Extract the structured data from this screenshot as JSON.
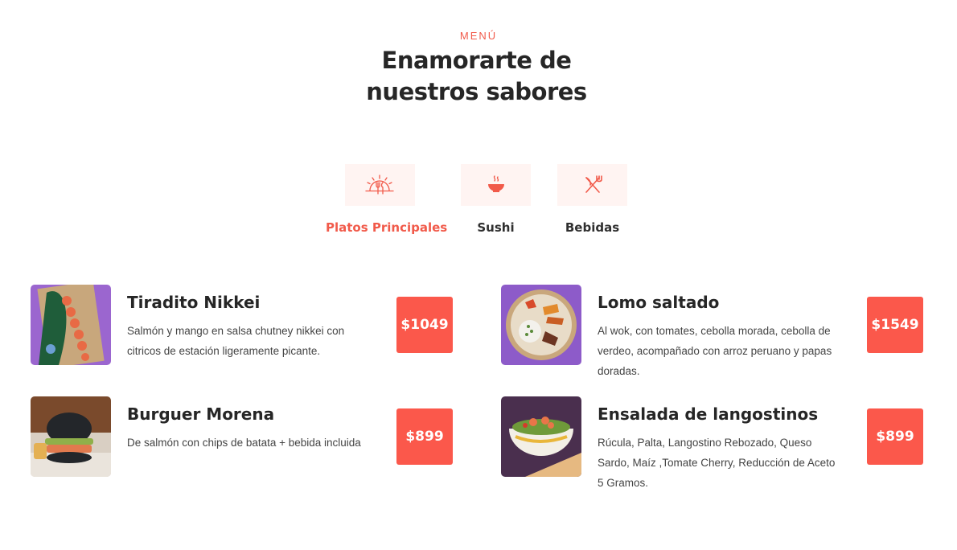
{
  "header": {
    "eyebrow": "MENÚ",
    "title_line1": "Enamorarte de",
    "title_line2": "nuestros sabores"
  },
  "tabs": [
    {
      "label": "Platos Principales",
      "icon": "plate-cutlery-icon",
      "active": true
    },
    {
      "label": "Sushi",
      "icon": "bowl-icon",
      "active": false
    },
    {
      "label": "Bebidas",
      "icon": "crossed-utensils-icon",
      "active": false
    }
  ],
  "dishes": [
    {
      "name": "Tiradito Nikkei",
      "description": "Salmón y mango en salsa chutney nikkei con citricos de estación ligeramente picante.",
      "price": "$1049"
    },
    {
      "name": "Lomo saltado",
      "description": "Al wok, con tomates, cebolla morada, cebolla de verdeo, acompañado con arroz peruano y papas doradas.",
      "price": "$1549"
    },
    {
      "name": "Burguer Morena",
      "description": "De salmón con chips de batata + bebida incluida",
      "price": "$899"
    },
    {
      "name": "Ensalada de langostinos",
      "description": "Rúcula, Palta, Langostino Rebozado, Queso Sardo, Maíz ,Tomate Cherry, Reducción de Aceto 5 Gramos.",
      "price": "$899"
    }
  ],
  "colors": {
    "accent": "#f15a4a",
    "price_bg": "#fb584b",
    "tab_bg": "#fff4f2"
  }
}
